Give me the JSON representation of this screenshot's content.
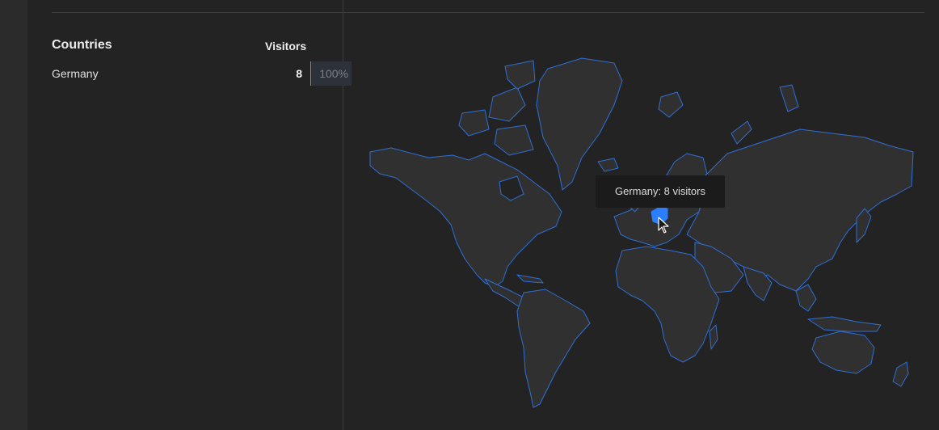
{
  "countries_panel": {
    "title": "Countries",
    "visitors_header": "Visitors",
    "rows": [
      {
        "country": "Germany",
        "visitors": "8",
        "percent": "100%"
      }
    ]
  },
  "map": {
    "tooltip": "Germany: 8 visitors",
    "highlight_color": "#2a7fff",
    "land_color": "#303030",
    "border_color": "#2f6fd6"
  }
}
